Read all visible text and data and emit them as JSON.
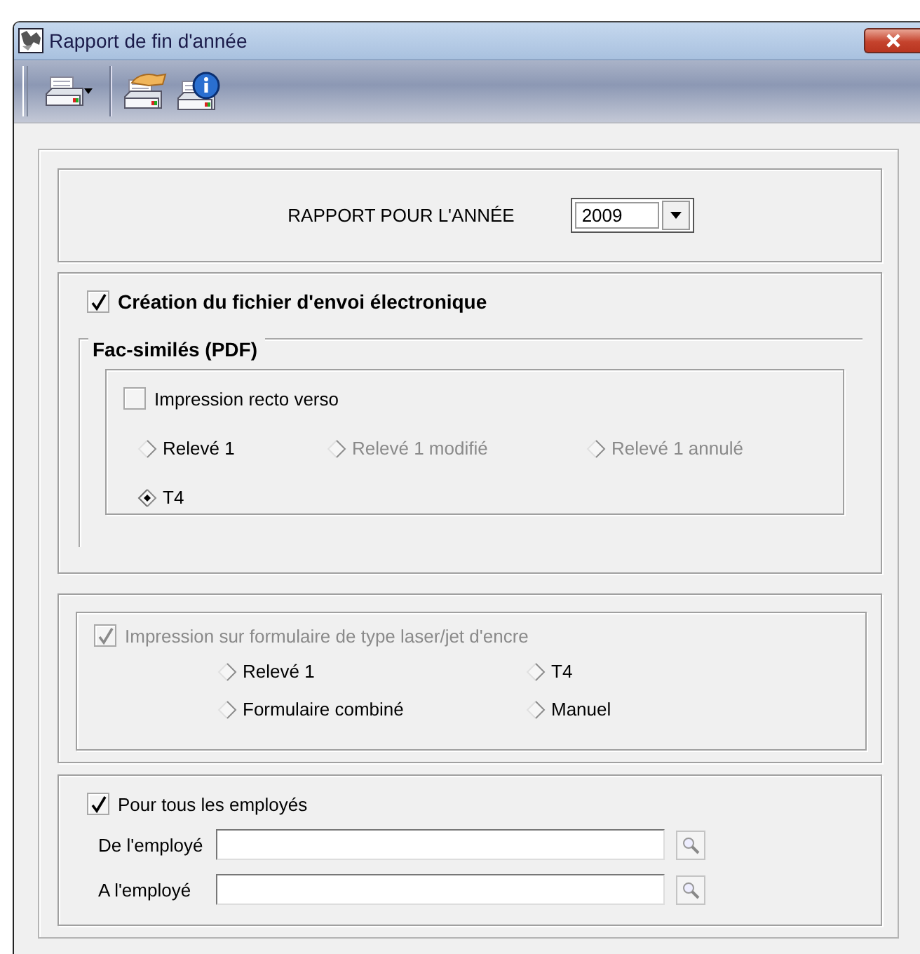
{
  "window": {
    "title": "Rapport de fin d'année"
  },
  "year": {
    "label": "RAPPORT POUR L'ANNÉE",
    "value": "2009"
  },
  "electronic": {
    "label": "Création du fichier d'envoi électronique",
    "checked": true
  },
  "facsimiles": {
    "title": "Fac-similés (PDF)",
    "duplex": {
      "label": "Impression recto verso",
      "checked": false
    },
    "options": [
      {
        "label": "Relevé 1",
        "selected": false,
        "disabled": false
      },
      {
        "label": "Relevé 1 modifié",
        "selected": false,
        "disabled": true
      },
      {
        "label": "Relevé 1 annulé",
        "selected": false,
        "disabled": true
      },
      {
        "label": "T4",
        "selected": true,
        "disabled": false
      }
    ]
  },
  "laser": {
    "label": "Impression sur formulaire de type laser/jet d'encre",
    "checked": true,
    "disabled": true,
    "options": [
      {
        "label": "Relevé 1",
        "selected": false
      },
      {
        "label": "T4",
        "selected": false
      },
      {
        "label": "Formulaire combiné",
        "selected": false
      },
      {
        "label": "Manuel",
        "selected": false
      }
    ]
  },
  "employees": {
    "all": {
      "label": "Pour tous les employés",
      "checked": true
    },
    "fields": [
      {
        "label": "De l'employé"
      },
      {
        "label": "A l'employé"
      }
    ]
  }
}
